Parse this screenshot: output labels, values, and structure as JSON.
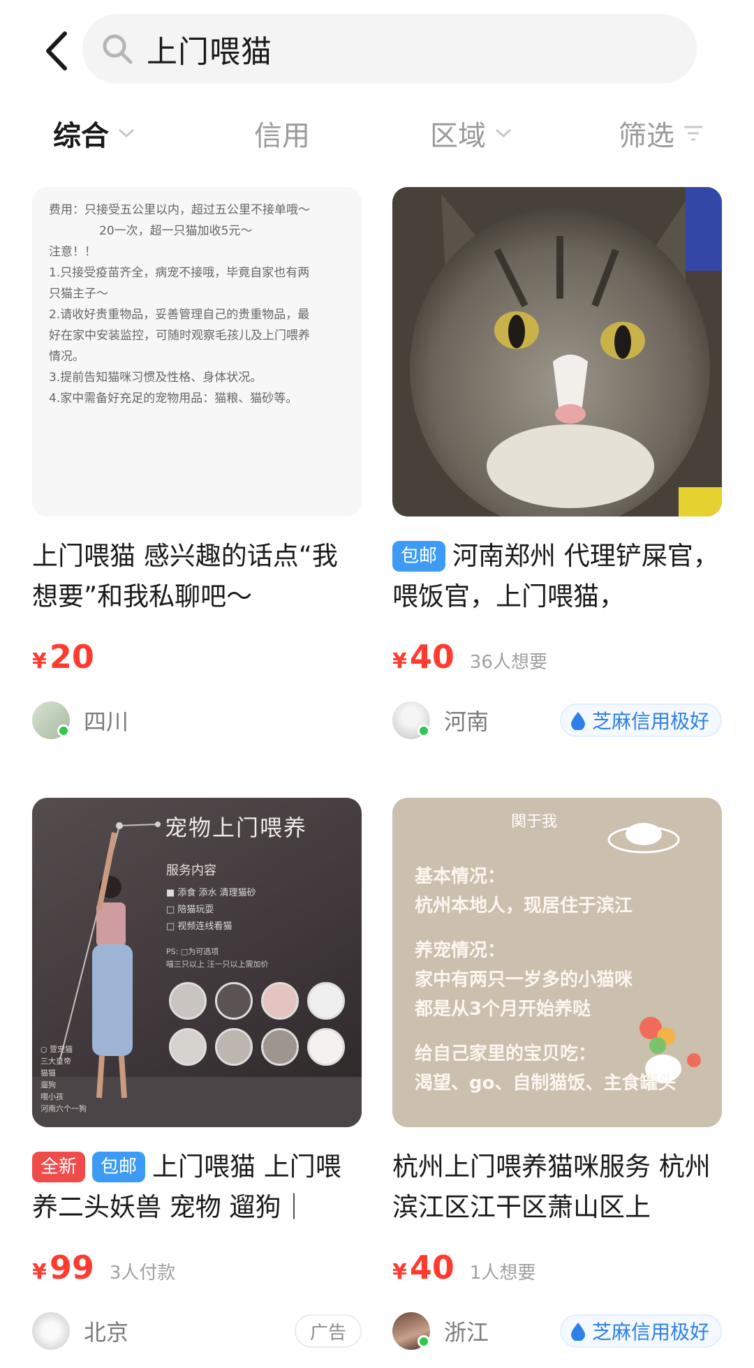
{
  "search": {
    "query": "上门喂猫"
  },
  "filters": [
    {
      "label": "综合"
    },
    {
      "label": "信用"
    },
    {
      "label": "区域"
    },
    {
      "label": "筛选"
    }
  ],
  "cards": [
    {
      "title": "上门喂猫 感兴趣的话点“我想要”和我私聊吧～",
      "price_symbol": "¥",
      "price": "20",
      "wants": "",
      "region": "四川",
      "note_lines": [
        "费用：只接受五公里以内，超过五公里不接单哦～",
        "20一次，超一只猫加收5元～",
        "注意！！",
        "1.只接受疫苗齐全，病宠不接哦，毕竟自家也有两",
        "只猫主子～",
        "2.请收好贵重物品，妥善管理自己的贵重物品，最",
        "好在家中安装监控，可随时观察毛孩儿及上门喂养",
        "情况。",
        "3.提前告知猫咪习惯及性格、身体状况。",
        "4.家中需备好充足的宠物用品：猫粮、猫砂等。"
      ]
    },
    {
      "tags": [
        "包邮"
      ],
      "title": "河南郑州 代理铲屎官，喂饭官，上门喂猫，",
      "price_symbol": "¥",
      "price": "40",
      "wants": "36人想要",
      "region": "河南",
      "credit": "芝麻信用极好"
    },
    {
      "tags": [
        "全新",
        "包邮"
      ],
      "title": "上门喂猫 上门喂养二头妖兽 宠物 遛狗｜",
      "price_symbol": "¥",
      "price": "99",
      "wants": "3人付款",
      "region": "北京",
      "ad": "广告",
      "poster": {
        "title": "宠物上门喂养",
        "subtitle": "服务内容",
        "items": [
          "■ 添食 添水 清理猫砂",
          "□ 陪猫玩耍",
          "□ 视频连线看猫"
        ],
        "ps_lines": [
          "PS: □为可选项",
          "喵三只以上 汪一只以上需加价"
        ],
        "side_lines": [
          "○ 萱宠猫",
          "三大皇帝",
          "猫猫",
          "遛狗",
          "喂小孩",
          "河南六个一狗"
        ]
      }
    },
    {
      "title": "杭州上门喂养猫咪服务 杭州滨江区江干区萧山区上",
      "price_symbol": "¥",
      "price": "40",
      "wants": "1人想要",
      "region": "浙江",
      "credit": "芝麻信用极好",
      "note": {
        "heading": "関于我",
        "lines": [
          "基本情况：",
          "杭州本地人，现居住于滨江",
          "",
          "养宠情况：",
          "家中有两只一岁多的小猫咪",
          "都是从3个月开始养哒",
          "",
          "给自己家里的宝贝吃：",
          "渴望、go、自制猫饭、主食罐头"
        ]
      }
    }
  ],
  "colors": {
    "price": "#ff3b30",
    "tag_blue": "#3d9bf6",
    "tag_red": "#f04b4b",
    "credit": "#2f7fe9",
    "online": "#2dc84d"
  }
}
